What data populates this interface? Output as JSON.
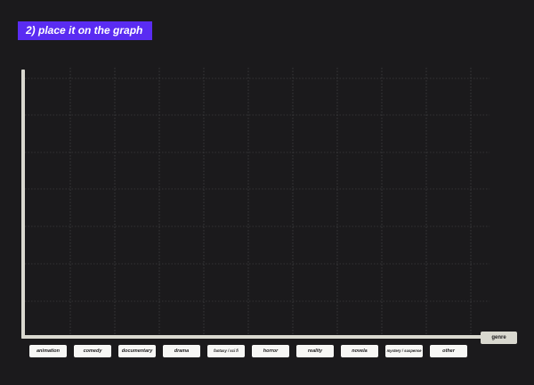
{
  "title": "2) place it on the graph",
  "axis_label": "genre",
  "genres": [
    "animation",
    "comedy",
    "documentary",
    "drama",
    "fantasy / sci fi",
    "horror",
    "reality",
    "novela",
    "mystery / suspense",
    "other"
  ],
  "colors": {
    "background": "#1b1a1c",
    "banner": "#5a2cf2",
    "axis": "#d9d8cf",
    "chip": "#f7f7f5",
    "grid": "#4a4a4a"
  }
}
